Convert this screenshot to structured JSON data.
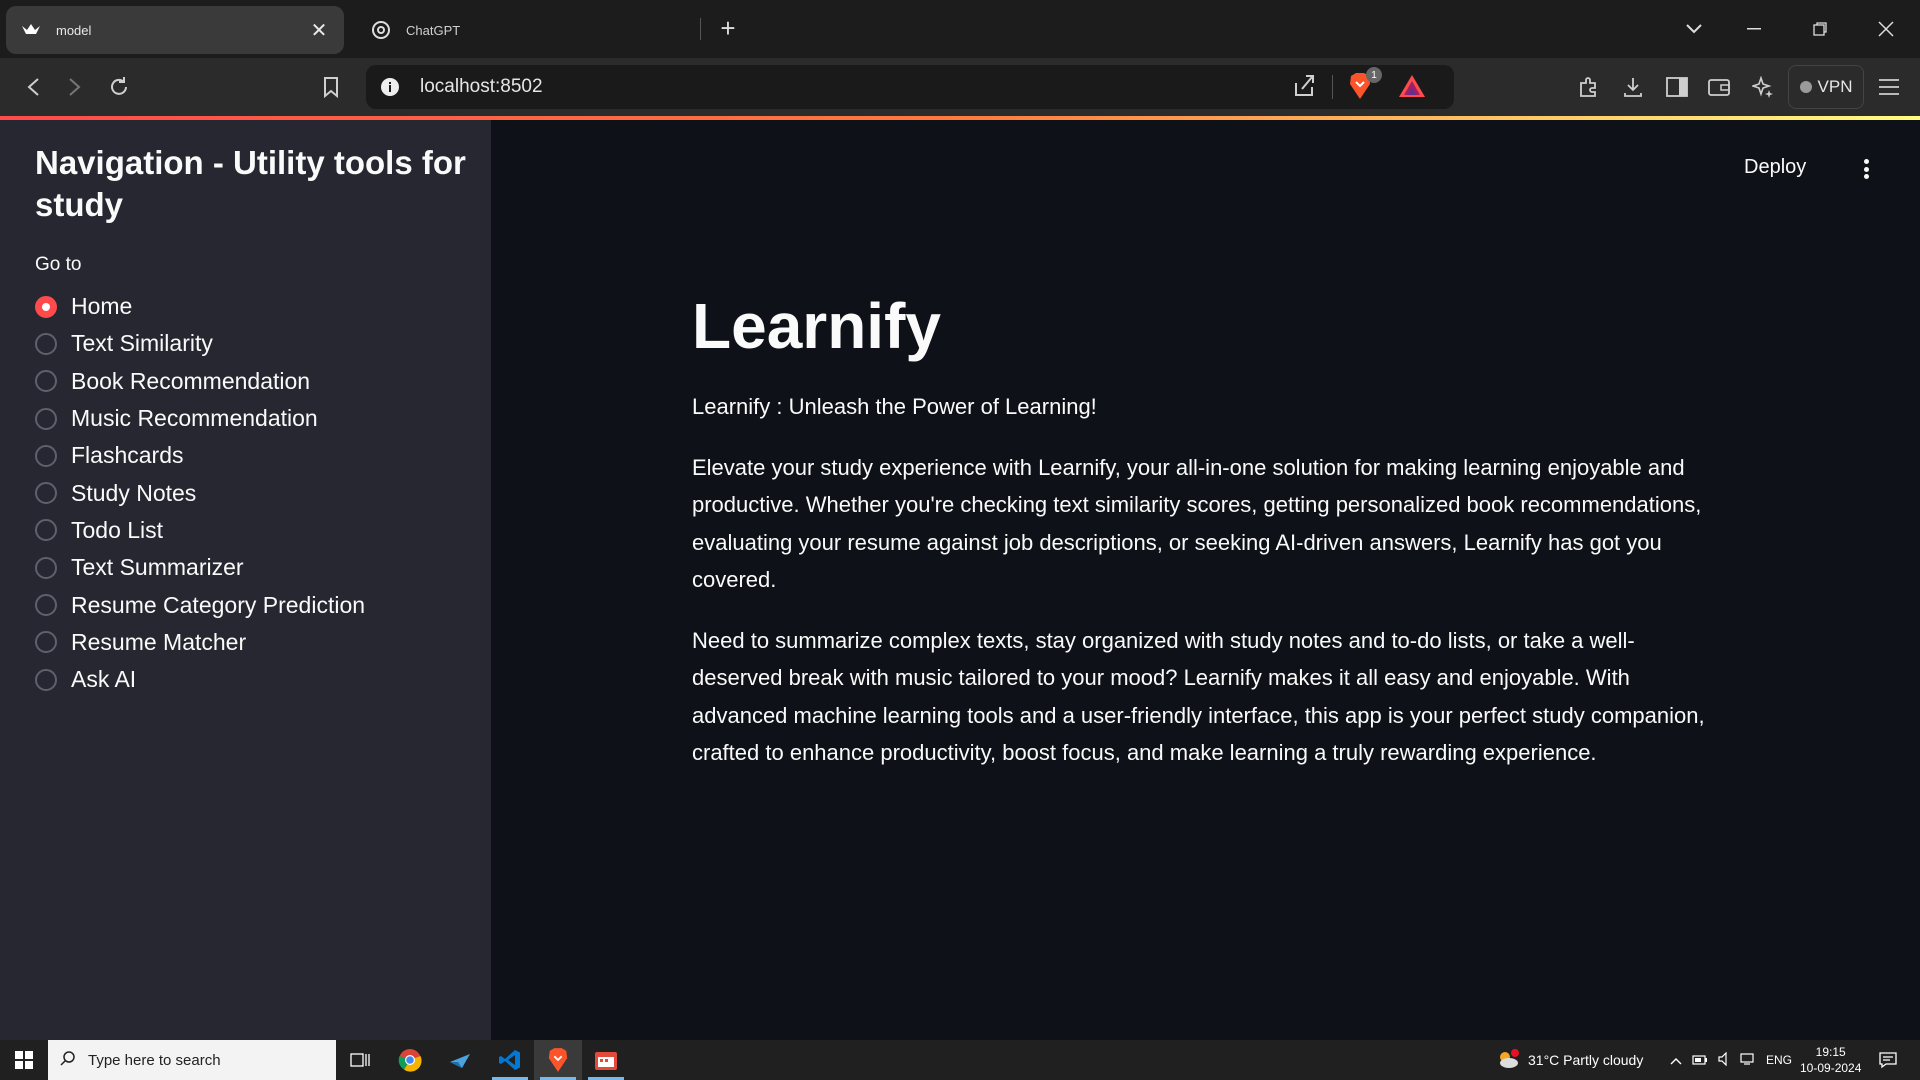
{
  "browser": {
    "tabs": [
      {
        "title": "model",
        "active": true
      },
      {
        "title": "ChatGPT",
        "active": false
      }
    ],
    "url": "localhost:8502",
    "shield_badge": "1",
    "vpn_label": "VPN"
  },
  "header": {
    "deploy_label": "Deploy"
  },
  "sidebar": {
    "title": "Navigation - Utility tools for study",
    "radio_label": "Go to",
    "options": [
      {
        "label": "Home",
        "selected": true
      },
      {
        "label": "Text Similarity",
        "selected": false
      },
      {
        "label": "Book Recommendation",
        "selected": false
      },
      {
        "label": "Music Recommendation",
        "selected": false
      },
      {
        "label": "Flashcards",
        "selected": false
      },
      {
        "label": "Study Notes",
        "selected": false
      },
      {
        "label": "Todo List",
        "selected": false
      },
      {
        "label": "Text Summarizer",
        "selected": false
      },
      {
        "label": "Resume Category Prediction",
        "selected": false
      },
      {
        "label": "Resume Matcher",
        "selected": false
      },
      {
        "label": "Ask AI",
        "selected": false
      }
    ]
  },
  "main": {
    "title": "Learnify",
    "tagline": "Learnify : Unleash the Power of Learning!",
    "paragraph1": "Elevate your study experience with Learnify, your all-in-one solution for making learning enjoyable and productive. Whether you're checking text similarity scores, getting personalized book recommendations, evaluating your resume against job descriptions, or seeking AI-driven answers, Learnify has got you covered.",
    "paragraph2": "Need to summarize complex texts, stay organized with study notes and to-do lists, or take a well-deserved break with music tailored to your mood? Learnify makes it all easy and enjoyable. With advanced machine learning tools and a user-friendly interface, this app is your perfect study companion, crafted to enhance productivity, boost focus, and make learning a truly rewarding experience."
  },
  "taskbar": {
    "search_placeholder": "Type here to search",
    "weather": "31°C  Partly cloudy",
    "language": "ENG",
    "time": "19:15",
    "date": "10-09-2024"
  },
  "colors": {
    "primary": "#ff4b4b",
    "background": "#0e1117",
    "sidebar_bg": "#262730"
  }
}
